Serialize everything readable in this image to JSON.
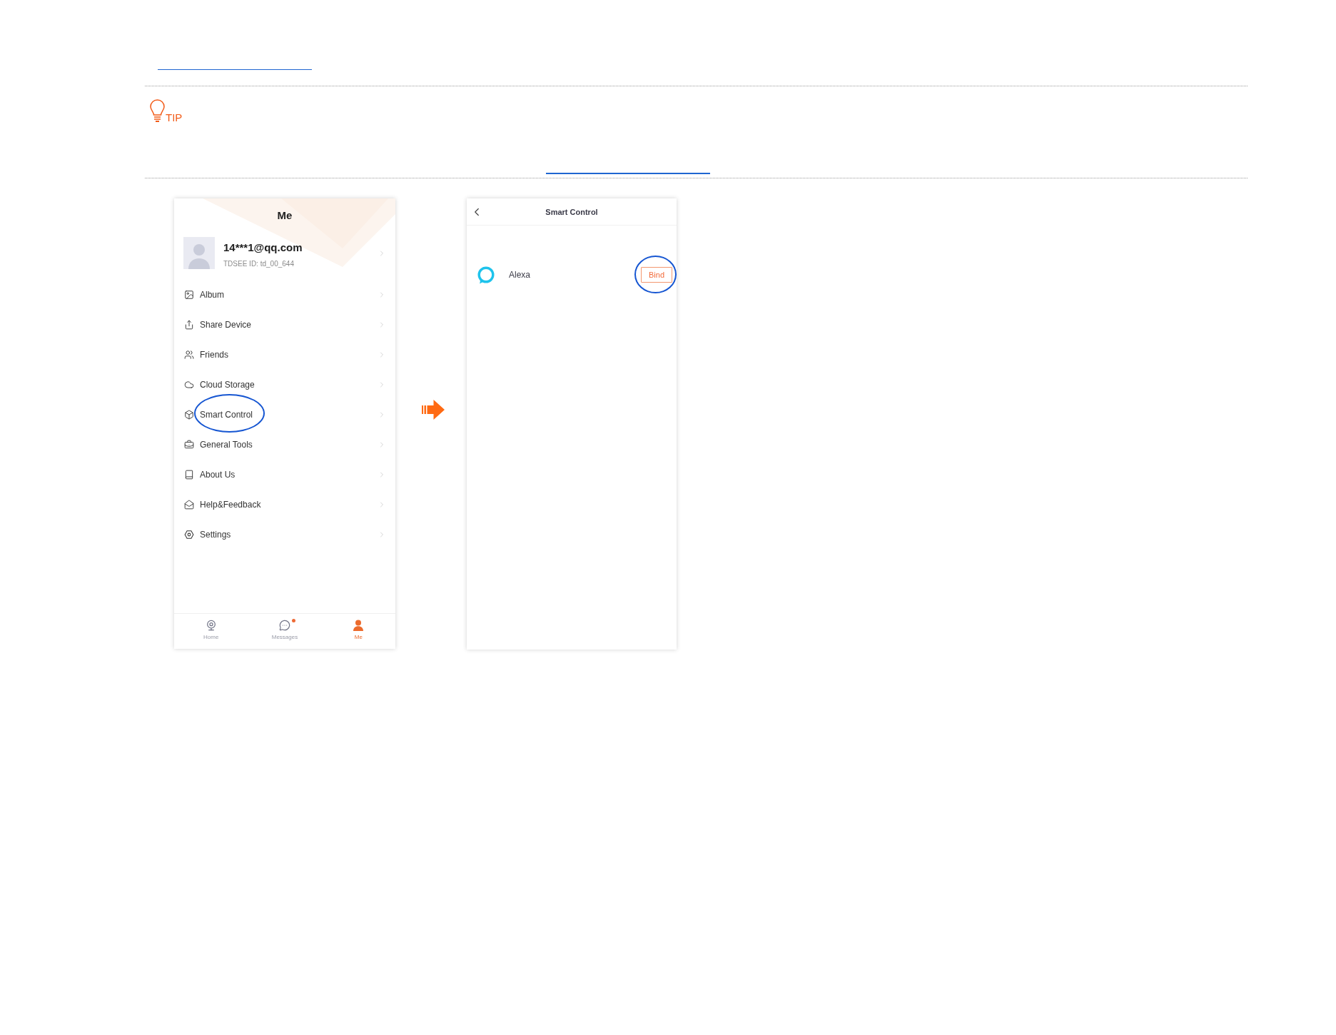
{
  "tip": {
    "label": "TIP"
  },
  "me_screen": {
    "title": "Me",
    "account": {
      "email": "14***1@qq.com",
      "user_id": "TDSEE ID: td_00_644"
    },
    "menu": [
      {
        "label": "Album",
        "highlighted": false
      },
      {
        "label": "Share Device",
        "highlighted": false
      },
      {
        "label": "Friends",
        "highlighted": false
      },
      {
        "label": "Cloud Storage",
        "highlighted": false
      },
      {
        "label": "Smart Control",
        "highlighted": true
      },
      {
        "label": "General Tools",
        "highlighted": false
      },
      {
        "label": "About Us",
        "highlighted": false
      },
      {
        "label": "Help&Feedback",
        "highlighted": false
      },
      {
        "label": "Settings",
        "highlighted": false
      }
    ],
    "tab_bar": [
      {
        "label": "Home",
        "selected": false,
        "badge": false
      },
      {
        "label": "Messages",
        "selected": false,
        "badge": true
      },
      {
        "label": "Me",
        "selected": true,
        "badge": false
      }
    ]
  },
  "smart_control_screen": {
    "title": "Smart Control",
    "services": [
      {
        "name": "Alexa",
        "button": "Bind",
        "highlighted": true
      }
    ]
  }
}
